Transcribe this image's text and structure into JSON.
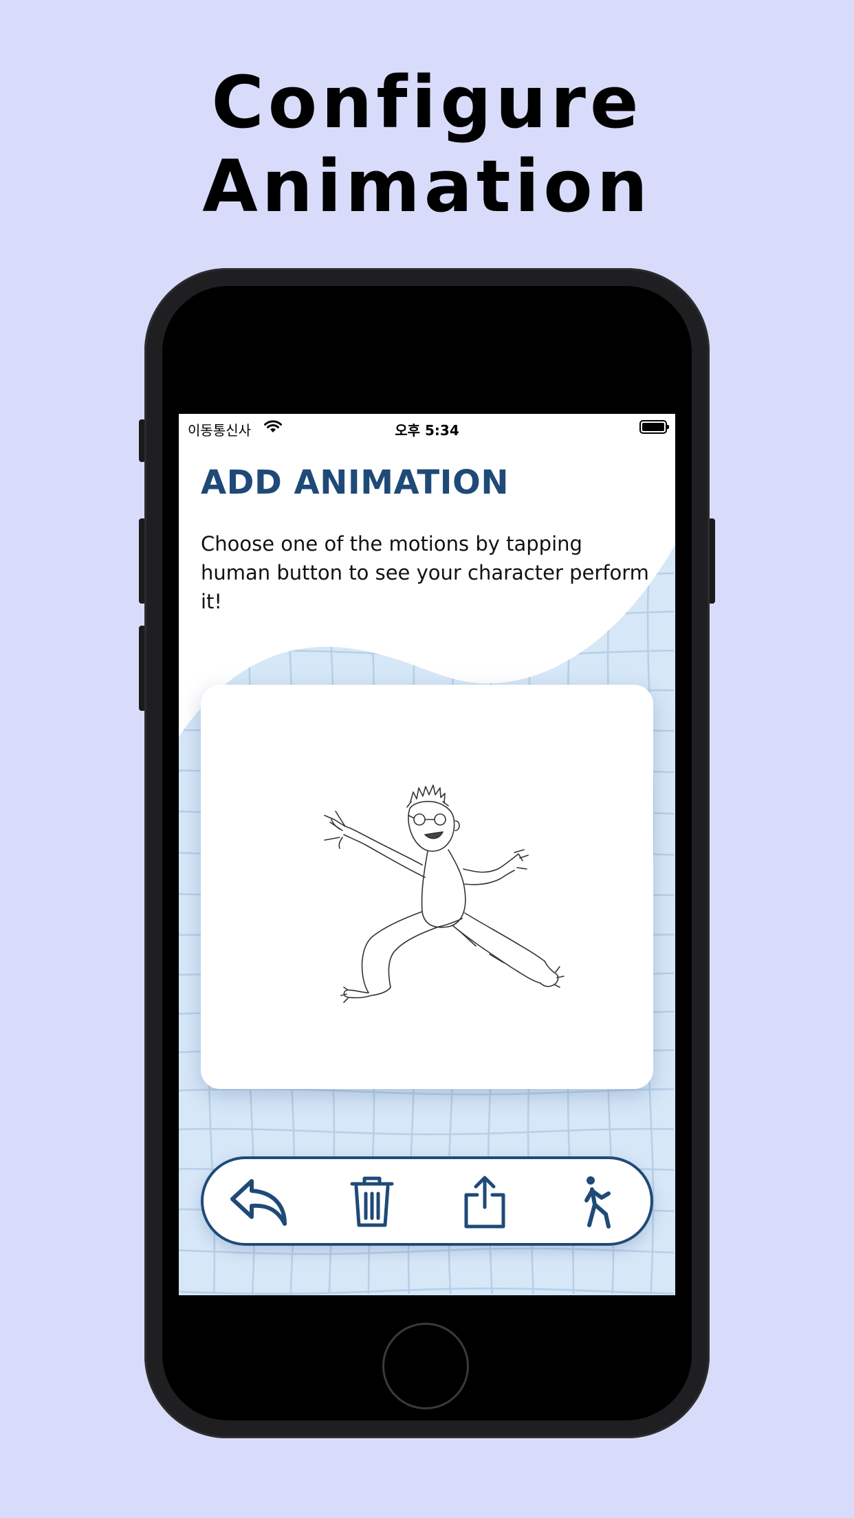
{
  "promo": {
    "headline_line1": "Configure",
    "headline_line2": "Animation",
    "background_color": "#d8dcfa"
  },
  "status_bar": {
    "carrier": "이동통신사",
    "time": "오후 5:34",
    "wifi_icon": "wifi-icon",
    "battery_icon": "battery-icon"
  },
  "screen": {
    "title": "ADD ANIMATION",
    "description": "Choose one of the motions by tapping human button to see your character perform it!",
    "accent_color": "#1f4a78",
    "grid_color": "#cfe3f6"
  },
  "card": {
    "image_icon": "stick-figure-drawing"
  },
  "toolbar": {
    "buttons": [
      {
        "icon": "undo-arrow-icon"
      },
      {
        "icon": "trash-icon"
      },
      {
        "icon": "share-icon"
      },
      {
        "icon": "human-motion-icon"
      }
    ]
  }
}
